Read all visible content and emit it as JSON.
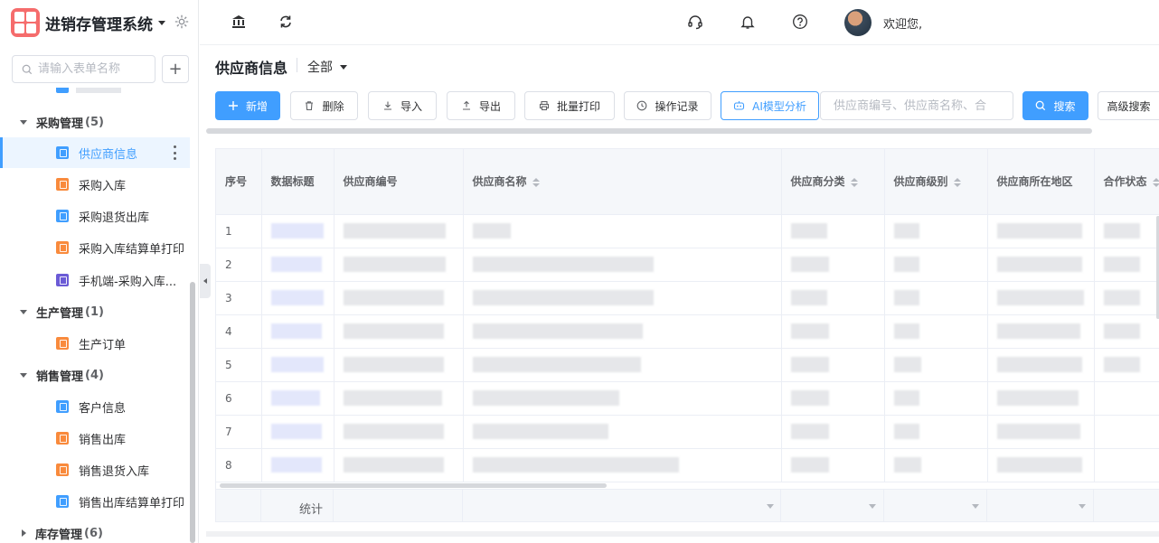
{
  "app": {
    "title": "进销存管理系统"
  },
  "sidebar": {
    "search_placeholder": "请输入表单名称",
    "add_symbol": "+",
    "groups": [
      {
        "name": "采购管理",
        "count": "(5)"
      },
      {
        "name": "生产管理",
        "count": "(1)"
      },
      {
        "name": "销售管理",
        "count": "(4)"
      },
      {
        "name": "库存管理",
        "count": "(6)"
      }
    ],
    "items": [
      {
        "label": "供应商信息",
        "color": "blue"
      },
      {
        "label": "采购入库",
        "color": "orange"
      },
      {
        "label": "采购退货出库",
        "color": "blue"
      },
      {
        "label": "采购入库结算单打印",
        "color": "orange"
      },
      {
        "label": "手机端-采购入库...",
        "color": "purple"
      },
      {
        "label": "生产订单",
        "color": "orange"
      },
      {
        "label": "客户信息",
        "color": "blue"
      },
      {
        "label": "销售出库",
        "color": "orange"
      },
      {
        "label": "销售退货入库",
        "color": "orange"
      },
      {
        "label": "销售出库结算单打印",
        "color": "blue"
      }
    ]
  },
  "topbar": {
    "welcome": "欢迎您,"
  },
  "page": {
    "title": "供应商信息",
    "scope": "全部"
  },
  "toolbar": {
    "add": "新增",
    "delete": "删除",
    "import": "导入",
    "export": "导出",
    "batch_print": "批量打印",
    "op_log": "操作记录",
    "ai": "AI模型分析",
    "search_placeholder": "供应商编号、供应商名称、合",
    "search": "搜索",
    "advanced": "高级搜索"
  },
  "table": {
    "columns": [
      "序号",
      "数据标题",
      "供应商编号",
      "供应商名称",
      "供应商分类",
      "供应商级别",
      "供应商所在地区",
      "合作状态"
    ],
    "rows": [
      "1",
      "2",
      "3",
      "4",
      "5",
      "6",
      "7",
      "8"
    ],
    "footer_label": "统计"
  },
  "colors": {
    "primary": "#409eff",
    "orange": "#f98a3c",
    "purple": "#6b5bd6",
    "logo": "#f56c6c"
  }
}
